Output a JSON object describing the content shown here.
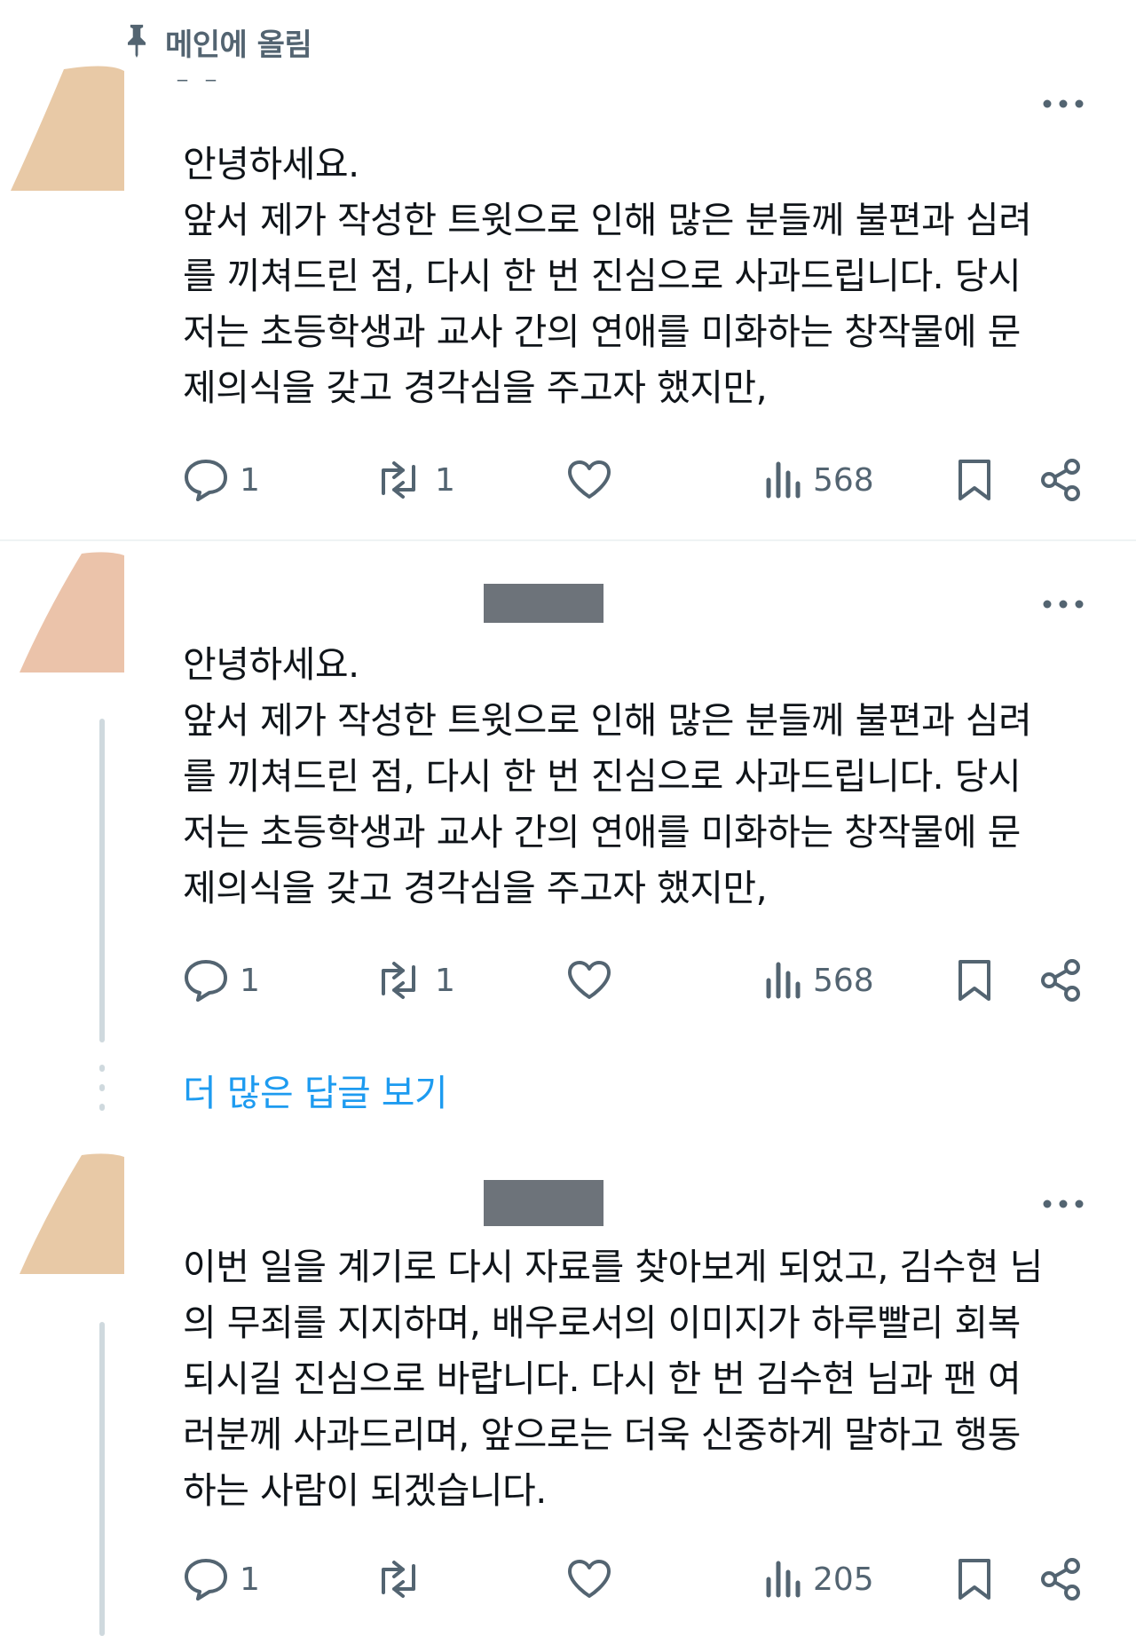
{
  "pinned": {
    "icon": "pin-icon",
    "label": "메인에 올림"
  },
  "tweets": [
    {
      "text": "안녕하세요.\n앞서 제가 작성한 트윗으로 인해 많은 분들께 불편과 심려\n를 끼쳐드린 점, 다시 한 번 진심으로 사과드립니다. 당시\n저는 초등학생과 교사 간의 연애를 미화하는 창작물에 문\n제의식을 갖고 경각심을 주고자 했지만,",
      "replies": "1",
      "retweets": "1",
      "likes": "",
      "views": "568"
    },
    {
      "text": "안녕하세요.\n앞서 제가 작성한 트윗으로 인해 많은 분들께 불편과 심려\n를 끼쳐드린 점, 다시 한 번 진심으로 사과드립니다. 당시\n저는 초등학생과 교사 간의 연애를 미화하는 창작물에 문\n제의식을 갖고 경각심을 주고자 했지만,",
      "replies": "1",
      "retweets": "1",
      "likes": "",
      "views": "568"
    },
    {
      "text": "이번 일을 계기로 다시 자료를 찾아보게 되었고, 김수현 님\n의 무죄를 지지하며, 배우로서의 이미지가 하루빨리 회복\n되시길 진심으로 바랍니다. 다시 한 번 김수현 님과 팬 여\n러분께 사과드리며, 앞으로는 더욱 신중하게 말하고 행동\n하는 사람이 되겠습니다.",
      "replies": "1",
      "retweets": "",
      "likes": "",
      "views": "205"
    }
  ],
  "show_more_replies": "더 많은 답글 보기",
  "colors": {
    "text": "#0f1419",
    "secondary": "#536471",
    "link": "#1d9bf0",
    "divider": "#eff3f4"
  }
}
